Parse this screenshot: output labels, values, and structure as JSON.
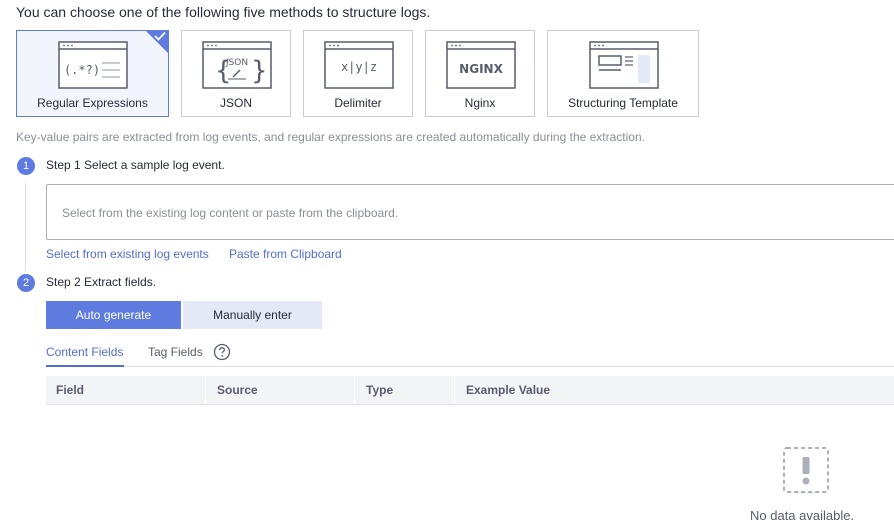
{
  "intro": "You can choose one of the following five methods to structure logs.",
  "methods": [
    {
      "label": "Regular Expressions",
      "icon": "regex-icon",
      "selected": true
    },
    {
      "label": "JSON",
      "icon": "json-icon",
      "selected": false
    },
    {
      "label": "Delimiter",
      "icon": "delimiter-icon",
      "selected": false
    },
    {
      "label": "Nginx",
      "icon": "nginx-icon",
      "selected": false
    },
    {
      "label": "Structuring Template",
      "icon": "template-icon",
      "selected": false
    }
  ],
  "icon_text": {
    "regex": "(.*?)",
    "json": "JSON",
    "delimiter": "x|y|z",
    "nginx": "NGINX"
  },
  "hint": "Key-value pairs are extracted from log events, and regular expressions are created automatically during the extraction.",
  "step1": {
    "number": "1",
    "title": "Step 1 Select a sample log event.",
    "placeholder": "Select from the existing log content or paste from the clipboard.",
    "links": [
      "Select from existing log events",
      "Paste from Clipboard"
    ]
  },
  "step2": {
    "number": "2",
    "title": "Step 2 Extract fields.",
    "auto_button": "Auto generate",
    "manual_button": "Manually enter"
  },
  "tabs": {
    "content": "Content Fields",
    "tag": "Tag Fields"
  },
  "table": {
    "columns": [
      "Field",
      "Source",
      "Type",
      "Example Value"
    ]
  },
  "empty": "No data available.",
  "colors": {
    "accent": "#5e7ce0",
    "link": "#526ecc",
    "border": "#c7cbd2"
  }
}
